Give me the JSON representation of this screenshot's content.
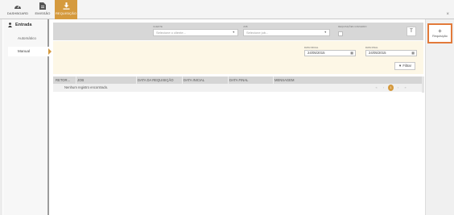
{
  "nav": {
    "items": [
      {
        "label": "DASHBOARD",
        "icon": "speedometer-icon"
      },
      {
        "label": "EMISSÃO",
        "icon": "document-icon"
      },
      {
        "label": "REQUISIÇÃO",
        "icon": "download-icon",
        "active": true
      }
    ],
    "close": "×"
  },
  "sidebar": {
    "header": "Entrada",
    "header_icon": "person-icon",
    "items": [
      {
        "label": "Automático"
      },
      {
        "label": "Manual",
        "active": true
      }
    ]
  },
  "filters": {
    "cliente_label": "CLIENTE",
    "cliente_placeholder": "Selecione o cliente...",
    "job_label": "JOB",
    "job_placeholder": "Selecione job...",
    "check_label": "REQUISIÇÕES COM ERRO",
    "filter_icon": "T"
  },
  "dates": {
    "start_label": "DATA INICIAL",
    "start_value": "24/05/2015",
    "end_label": "DATA FINAL",
    "end_value": "24/05/2015",
    "button": "Filtrar"
  },
  "table": {
    "headers": [
      "RETOR...",
      "JOB",
      "DATA DA REQUISIÇÃO",
      "DATA INICIAL",
      "DATA FINAL",
      "MENSAGEM"
    ],
    "empty_message": "Nenhum registro encontrado.",
    "pager": {
      "first": "«",
      "prev": "‹",
      "current": "1",
      "next": "›",
      "last": "»"
    }
  },
  "right": {
    "new_label": "Requisição",
    "new_plus": "+"
  },
  "colors": {
    "accent": "#d59a3e",
    "highlight_border": "#e27a3a",
    "filter_bg": "#d7d7d7",
    "date_bg": "#fdf7e6"
  }
}
